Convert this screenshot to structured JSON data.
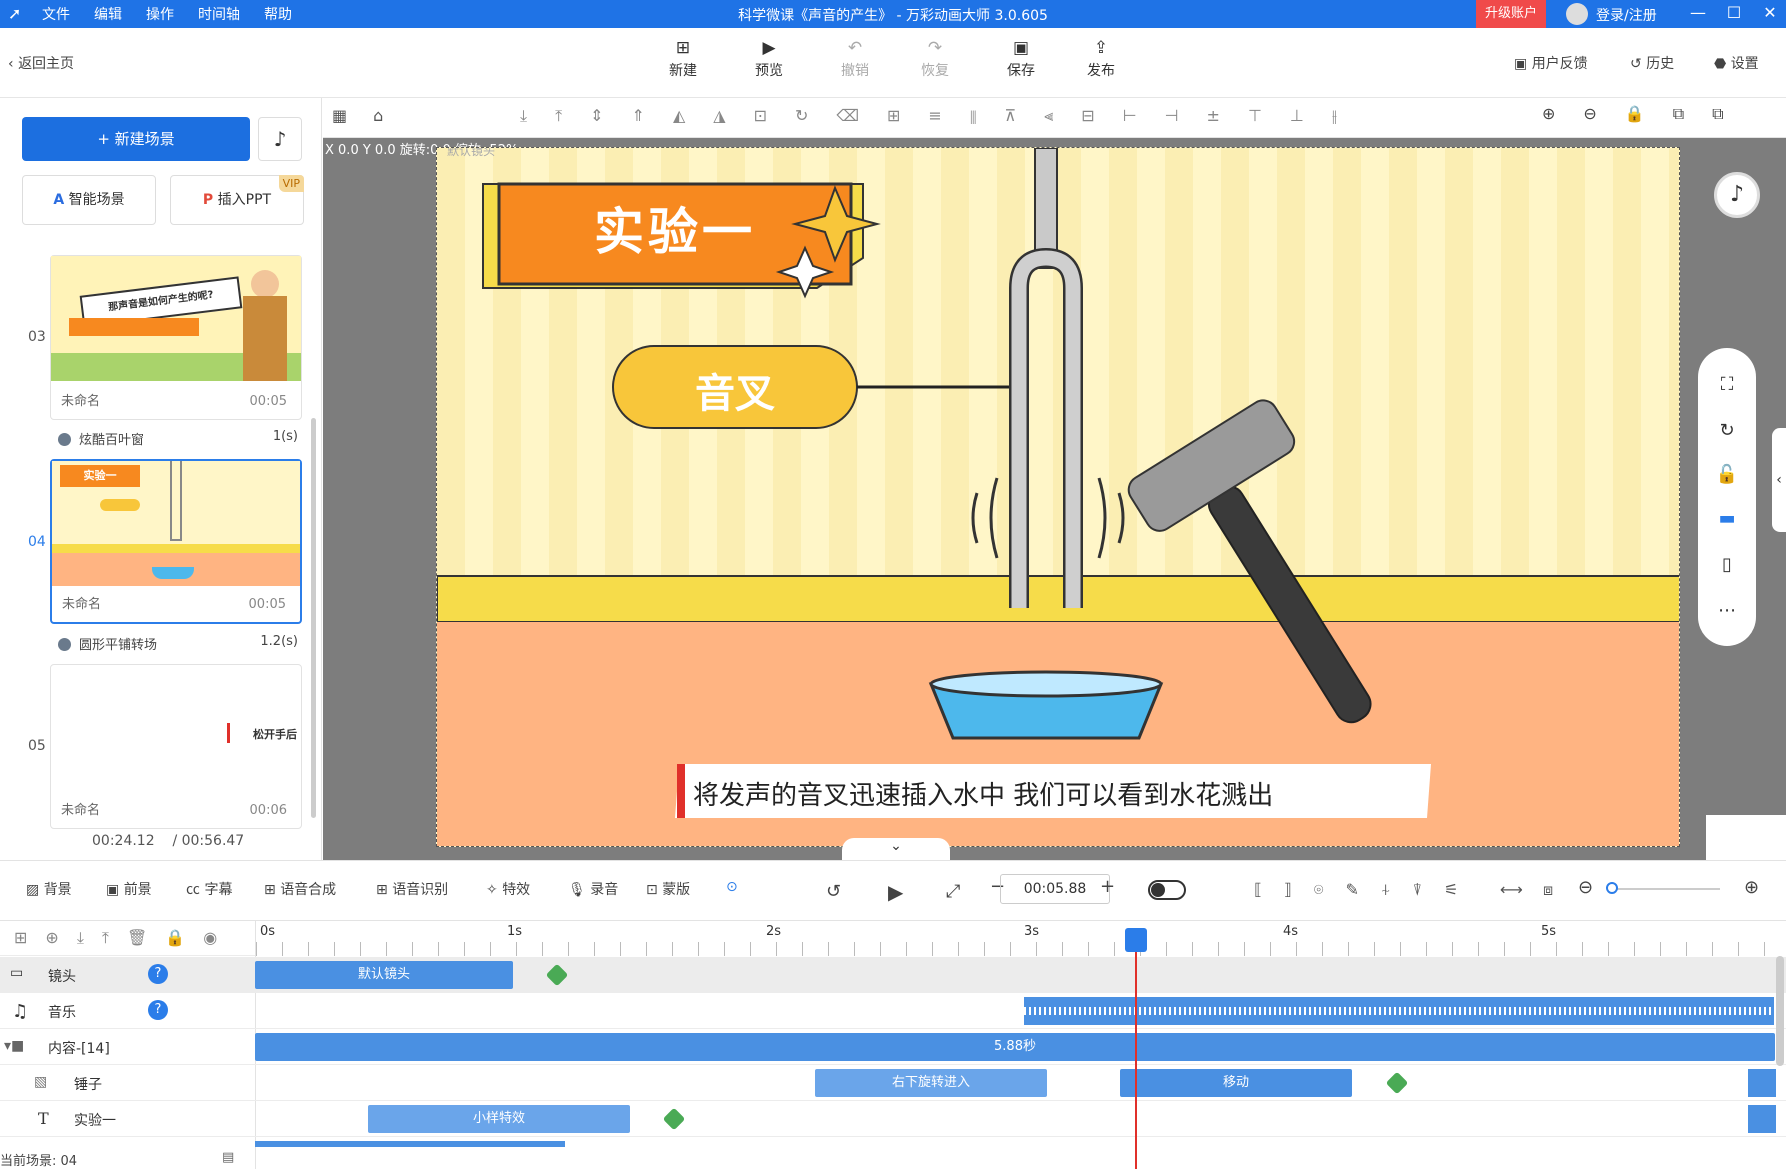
{
  "titlebar": {
    "menus": [
      "文件",
      "编辑",
      "操作",
      "时间轴",
      "帮助"
    ],
    "window_title": "科学微课《声音的产生》 - 万彩动画大师 3.0.605",
    "upgrade": "升级账户",
    "login": "登录/注册"
  },
  "toolbar": {
    "back": "返回主页",
    "buttons": [
      "新建",
      "预览",
      "撤销",
      "恢复",
      "保存",
      "发布"
    ],
    "right_links": [
      "用户反馈",
      "历史",
      "设置"
    ]
  },
  "left": {
    "new_scene": "+ 新建场景",
    "smart_scene": "智能场景",
    "insert_ppt": "插入PPT",
    "vip": "VIP",
    "scenes": [
      {
        "num": "03",
        "name": "未命名",
        "duration": "00:05",
        "caption": "那声音是如何产生的呢?"
      },
      {
        "num": "04",
        "name": "未命名",
        "duration": "00:05",
        "caption": "实验一"
      },
      {
        "num": "05",
        "name": "未命名",
        "duration": "00:06",
        "caption": "松开手后"
      }
    ],
    "transitions": [
      {
        "name": "炫酷百叶窗",
        "duration": "1(s)"
      },
      {
        "name": "圆形平铺转场",
        "duration": "1.2(s)"
      }
    ],
    "current_time": "00:24.12",
    "total_time": "/ 00:56.47"
  },
  "canvas": {
    "coords": "X 0.0 Y 0.0 旋转:0.0 缩放: 52%",
    "lens_label": "默认镜头",
    "banner": "实验一",
    "fork_label": "音叉",
    "subtitle": "将发声的音叉迅速插入水中 我们可以看到水花溅出",
    "colors": {
      "wall": "#fff6c8",
      "stripe": "#fbeeb3",
      "shelf": "#f6dc4a",
      "floor": "#ffb482",
      "banner": "#f7891f"
    }
  },
  "controls": {
    "tools": [
      "背景",
      "前景",
      "字幕",
      "语音合成",
      "语音识别",
      "特效",
      "录音",
      "蒙版"
    ],
    "time": "00:05.88"
  },
  "timeline": {
    "ticks": [
      "0s",
      "1s",
      "2s",
      "3s",
      "4s",
      "5s"
    ],
    "tracks": [
      {
        "name": "镜头",
        "clips": [
          "默认镜头"
        ]
      },
      {
        "name": "音乐",
        "clips": []
      },
      {
        "name": "内容-[14]",
        "clips": [
          "5.88秒"
        ]
      },
      {
        "name": "锤子",
        "clips": [
          "右下旋转进入",
          "移动"
        ]
      },
      {
        "name": "实验一",
        "clips": [
          "小样特效"
        ]
      }
    ],
    "current_scene": "当前场景: 04"
  }
}
